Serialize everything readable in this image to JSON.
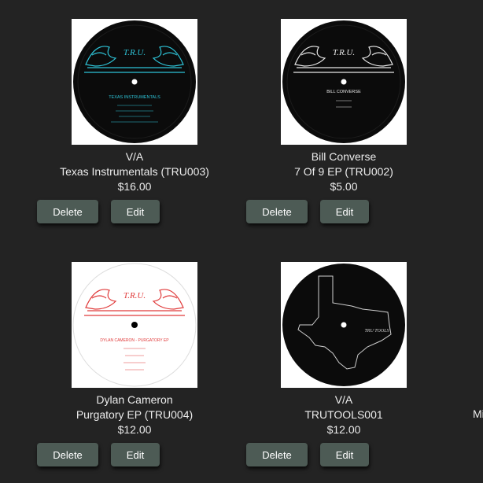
{
  "products": [
    {
      "artist": "V/A",
      "title": "Texas Instrumentals (TRU003)",
      "price": "$16.00",
      "cover": {
        "label_color": "#2ec4d8",
        "label_logo": "T.R.U.",
        "label_title": "TEXAS INSTRUMENTALS"
      }
    },
    {
      "artist": "Bill Converse",
      "title": "7 Of 9 EP (TRU002)",
      "price": "$5.00",
      "cover": {
        "label_color": "#111111",
        "label_logo": "T.R.U.",
        "label_title": "BILL CONVERSE"
      }
    },
    {
      "artist": "Dylan Cameron",
      "title": "Purgatory EP (TRU004)",
      "price": "$12.00",
      "cover": {
        "label_color": "#e03a3a",
        "label_logo": "T.R.U.",
        "label_title": "DYLAN CAMERON - PURGATORY EP"
      }
    },
    {
      "artist": "V/A",
      "title": "TRUTOOLS001",
      "price": "$12.00",
      "cover": {
        "label_color": "#111111",
        "label_logo": "TRU TOOLS"
      }
    }
  ],
  "actions": {
    "delete_label": "Delete",
    "edit_label": "Edit"
  },
  "partial_next_title": "Mi",
  "colors": {
    "background": "#232323",
    "button": "#4d5b55",
    "text": "#ececec"
  }
}
